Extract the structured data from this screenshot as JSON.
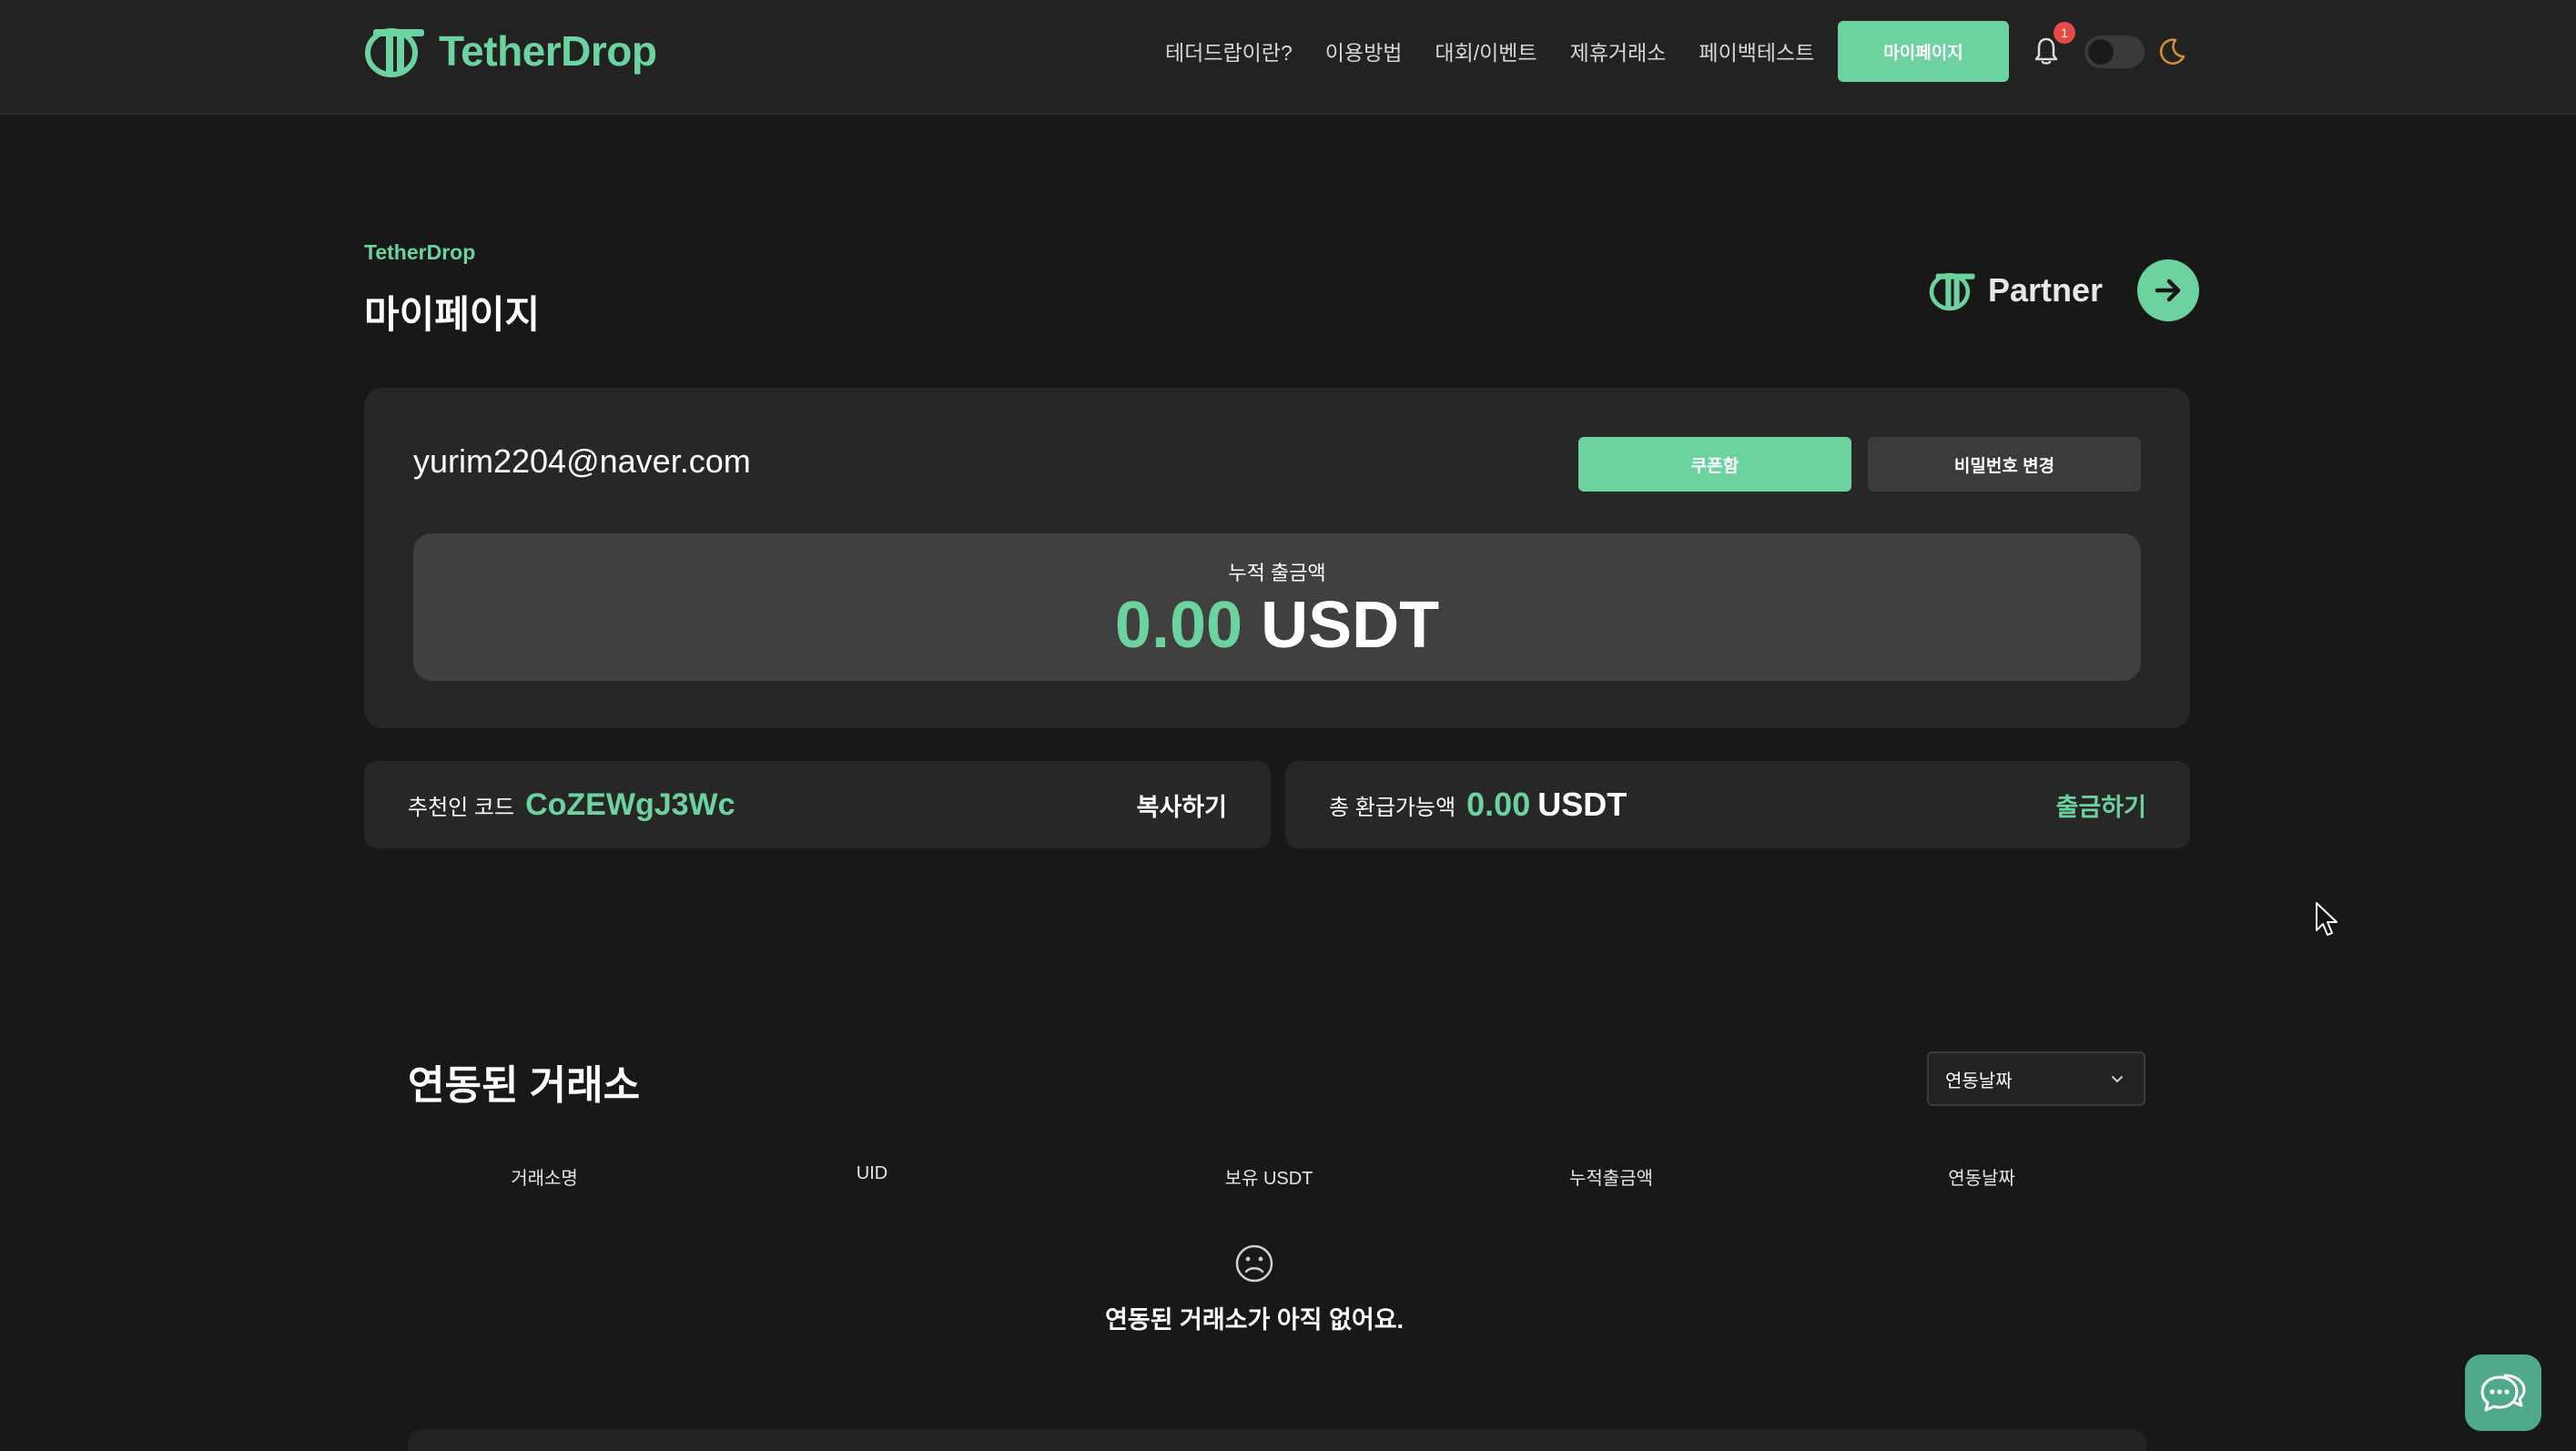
{
  "header": {
    "logo_text": "TetherDrop",
    "nav": [
      "테더드랍이란?",
      "이용방법",
      "대회/이벤트",
      "제휴거래소",
      "페이백테스트"
    ],
    "mypage_button": "마이페이지",
    "notification_count": "1"
  },
  "page": {
    "brand_sub": "TetherDrop",
    "title": "마이페이지",
    "partner_label": "Partner"
  },
  "account": {
    "email": "yurim2204@naver.com",
    "coupon_button": "쿠폰함",
    "password_button": "비밀번호 변경",
    "total_label": "누적 출금액",
    "total_value": "0.00",
    "total_unit": "USDT"
  },
  "referral": {
    "label": "추천인 코드",
    "code": "CoZEWgJ3Wc",
    "copy_button": "복사하기"
  },
  "refund": {
    "label": "총 환급가능액",
    "value": "0.00",
    "unit": "USDT",
    "withdraw_button": "출금하기"
  },
  "exchanges": {
    "title": "연동된 거래소",
    "sort_value": "연동날짜",
    "columns": [
      "거래소명",
      "UID",
      "보유 USDT",
      "누적출금액",
      "연동날짜"
    ],
    "empty_message": "연동된 거래소가 아직 없어요."
  },
  "colors": {
    "accent": "#6cd3a0",
    "background": "#181818",
    "card": "#272727",
    "badge": "#e84a4a"
  },
  "icons": [
    "logo-icon",
    "bell-icon",
    "moon-icon",
    "arrow-right-icon",
    "chevron-down-icon",
    "sad-face-icon",
    "chat-icon",
    "cursor-icon"
  ]
}
